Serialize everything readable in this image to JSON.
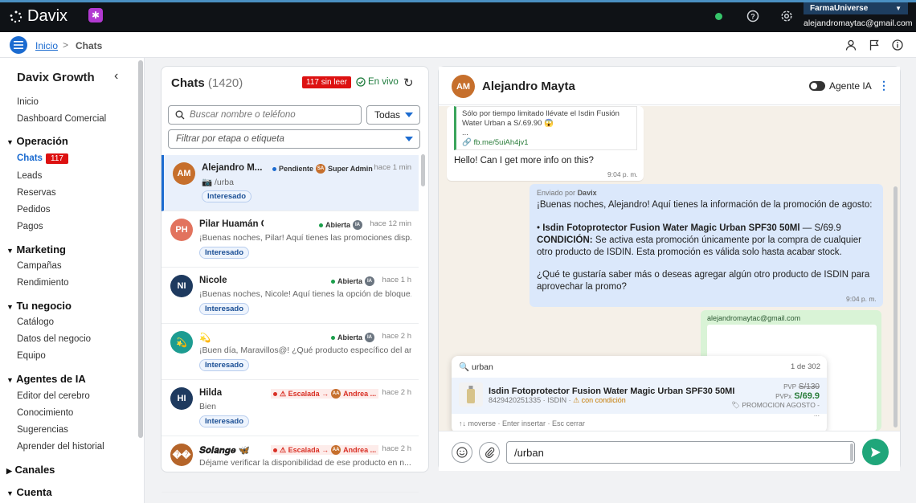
{
  "topbar": {
    "logo_text": "Davix",
    "org_name": "FarmaUniverse",
    "user_email": "alejandromaytac@gmail.com",
    "status_color": "#36c46a",
    "icons": [
      "help-icon",
      "settings-icon"
    ]
  },
  "breadcrumb": {
    "home": "Inicio",
    "separator": ">",
    "current": "Chats",
    "right_icons": [
      "user-icon",
      "flag-icon",
      "info-icon"
    ]
  },
  "sidebar": {
    "title": "Davix Growth",
    "items": [
      {
        "label": "Inicio"
      },
      {
        "label": "Dashboard Comercial"
      }
    ],
    "sections": [
      {
        "label": "Operación",
        "expanded": true,
        "items": [
          {
            "label": "Chats",
            "active": true,
            "badge": "117"
          },
          {
            "label": "Leads"
          },
          {
            "label": "Reservas"
          },
          {
            "label": "Pedidos"
          },
          {
            "label": "Pagos"
          }
        ]
      },
      {
        "label": "Marketing",
        "expanded": true,
        "items": [
          {
            "label": "Campañas"
          },
          {
            "label": "Rendimiento"
          }
        ]
      },
      {
        "label": "Tu negocio",
        "expanded": true,
        "items": [
          {
            "label": "Catálogo"
          },
          {
            "label": "Datos del negocio"
          },
          {
            "label": "Equipo"
          }
        ]
      },
      {
        "label": "Agentes de IA",
        "expanded": true,
        "items": [
          {
            "label": "Editor del cerebro"
          },
          {
            "label": "Conocimiento"
          },
          {
            "label": "Sugerencias"
          },
          {
            "label": "Aprender del historial"
          }
        ]
      },
      {
        "label": "Canales",
        "expanded": false,
        "items": []
      },
      {
        "label": "Cuenta",
        "expanded": true,
        "items": []
      }
    ]
  },
  "chat_list": {
    "title": "Chats",
    "count": "(1420)",
    "unread_badge": "117 sin leer",
    "live_label": "En vivo",
    "search_placeholder": "Buscar nombre o teléfono",
    "filter_value": "Todas",
    "stage_placeholder": "Filtrar por etapa o etiqueta",
    "rows": [
      {
        "initials": "AM",
        "avatar_color": "#c66f2c",
        "name": "Alejandro M...",
        "status": "Pendiente",
        "status_color": "#1b6bd0",
        "assignee_initials": "SA",
        "assignee": "Super Admin",
        "time": "hace 1 min",
        "preview": "📷 /urba",
        "tag": "Interesado",
        "selected": true
      },
      {
        "initials": "PH",
        "avatar_color": "#e2735e",
        "name": "Pilar Huamán Camacho",
        "status": "Abierta",
        "status_color": "#1b9e4b",
        "assignee_initials": "IA",
        "assignee": "",
        "time": "hace 12 min",
        "preview": "¡Buenas noches, Pilar! Aquí tienes las promociones disp...",
        "tag": "Interesado"
      },
      {
        "initials": "NI",
        "avatar_color": "#1e3a5f",
        "name": "Nicole",
        "status": "Abierta",
        "status_color": "#1b9e4b",
        "assignee_initials": "IA",
        "assignee": "",
        "time": "hace 1 h",
        "preview": "¡Buenas noches, Nicole! Aquí tienes la opción de bloque...",
        "tag": "Interesado"
      },
      {
        "initials": "💫",
        "avatar_color": "#1d9c91",
        "name": "💫",
        "status": "Abierta",
        "status_color": "#1b9e4b",
        "assignee_initials": "IA",
        "assignee": "",
        "time": "hace 2 h",
        "preview": "¡Buen día, Maravillos@! ¿Qué producto específico del an...",
        "tag": "Interesado"
      },
      {
        "initials": "HI",
        "avatar_color": "#1e3a5f",
        "name": "Hilda",
        "status": "⚠ Escalada →",
        "status_color": "#d93025",
        "assignee_initials": "AA",
        "assignee": "Andrea ...",
        "time": "hace 2 h",
        "preview": "Bien",
        "tag": "Interesado"
      },
      {
        "initials": "��",
        "avatar_color": "#b5652a",
        "name": "𝑺𝒐𝒍𝒂𝒏𝒈𝒆 🦋",
        "status": "⚠ Escalada →",
        "status_color": "#d93025",
        "assignee_initials": "AA",
        "assignee": "Andrea ...",
        "time": "hace 2 h",
        "preview": "Déjame verificar la disponibilidad de ese producto en n...",
        "tag": ""
      }
    ]
  },
  "conversation": {
    "initials": "AM",
    "name": "Alejandro Mayta",
    "agent_toggle_label": "Agente IA",
    "agent_toggle_on": false,
    "incoming": {
      "quote_line1": "Sólo por tiempo limitado llévate el Isdin Fusión",
      "quote_line2": "Water Urban a S/.69.90 😱",
      "quote_line3": "...",
      "quote_link": "🔗 fb.me/5uiAh4jv1",
      "text": "Hello! Can I get more info on this?",
      "time": "9:04 p. m."
    },
    "outgoing": {
      "sender_prefix": "Enviado por",
      "sender": "Davix",
      "line1": "¡Buenas noches, Alejandro! Aquí tienes la información de la promoción de agosto:",
      "product_bullet": "• ",
      "product_name": "Isdin Fotoprotector Fusion Water Magic Urban SPF30 50Ml",
      "product_price": " — S/69.9",
      "condition_label": "CONDICIÓN:",
      "condition_text": " Se activa esta promoción únicamente por la compra de cualquier otro producto de ISDIN. Esta promoción es válida solo hasta acabar stock.",
      "question": "¿Qué te gustaría saber más o deseas agregar algún otro producto de ISDIN para aprovechar la promo?",
      "time": "9:04 p. m."
    },
    "email_card": {
      "from": "alejandromaytac@gmail.com"
    }
  },
  "product_popup": {
    "query": "🔍 urban",
    "count": "1 de 302",
    "item": {
      "name": "Isdin Fotoprotector Fusion Water Magic Urban SPF30 50MI",
      "sku": "8429420251335",
      "brand": "ISDIN",
      "condition": "⚠ con condición",
      "pvp_label": "PVP",
      "pvp": "S/130",
      "pvpx_label": "PVPx",
      "pvpx": "S/69.9",
      "promo": "🏷 PROMOCION AGOSTO - ..."
    },
    "hint": "↑↓ moverse · Enter insertar · Esc cerrar"
  },
  "composer": {
    "value": "/urban",
    "icons": [
      "emoji-icon",
      "attach-icon",
      "send-icon"
    ]
  }
}
